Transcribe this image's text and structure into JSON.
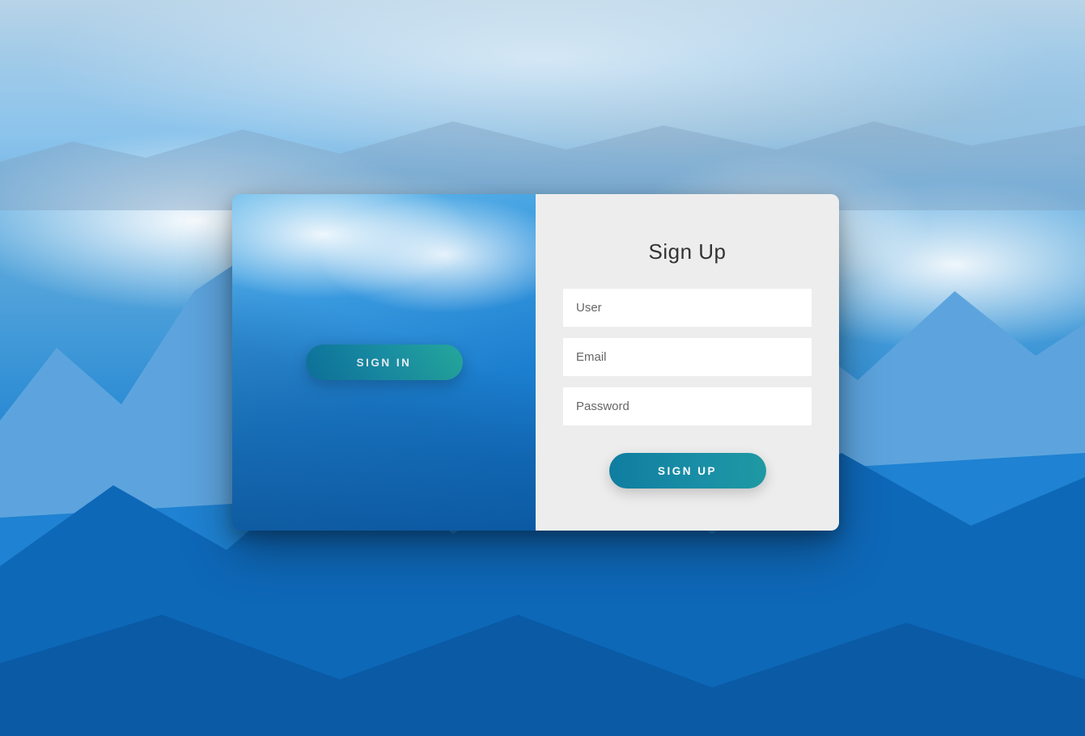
{
  "left": {
    "signin_label": "Sign In"
  },
  "right": {
    "title": "Sign Up",
    "user_placeholder": "User",
    "email_placeholder": "Email",
    "password_placeholder": "Password",
    "signup_label": "Sign Up"
  }
}
